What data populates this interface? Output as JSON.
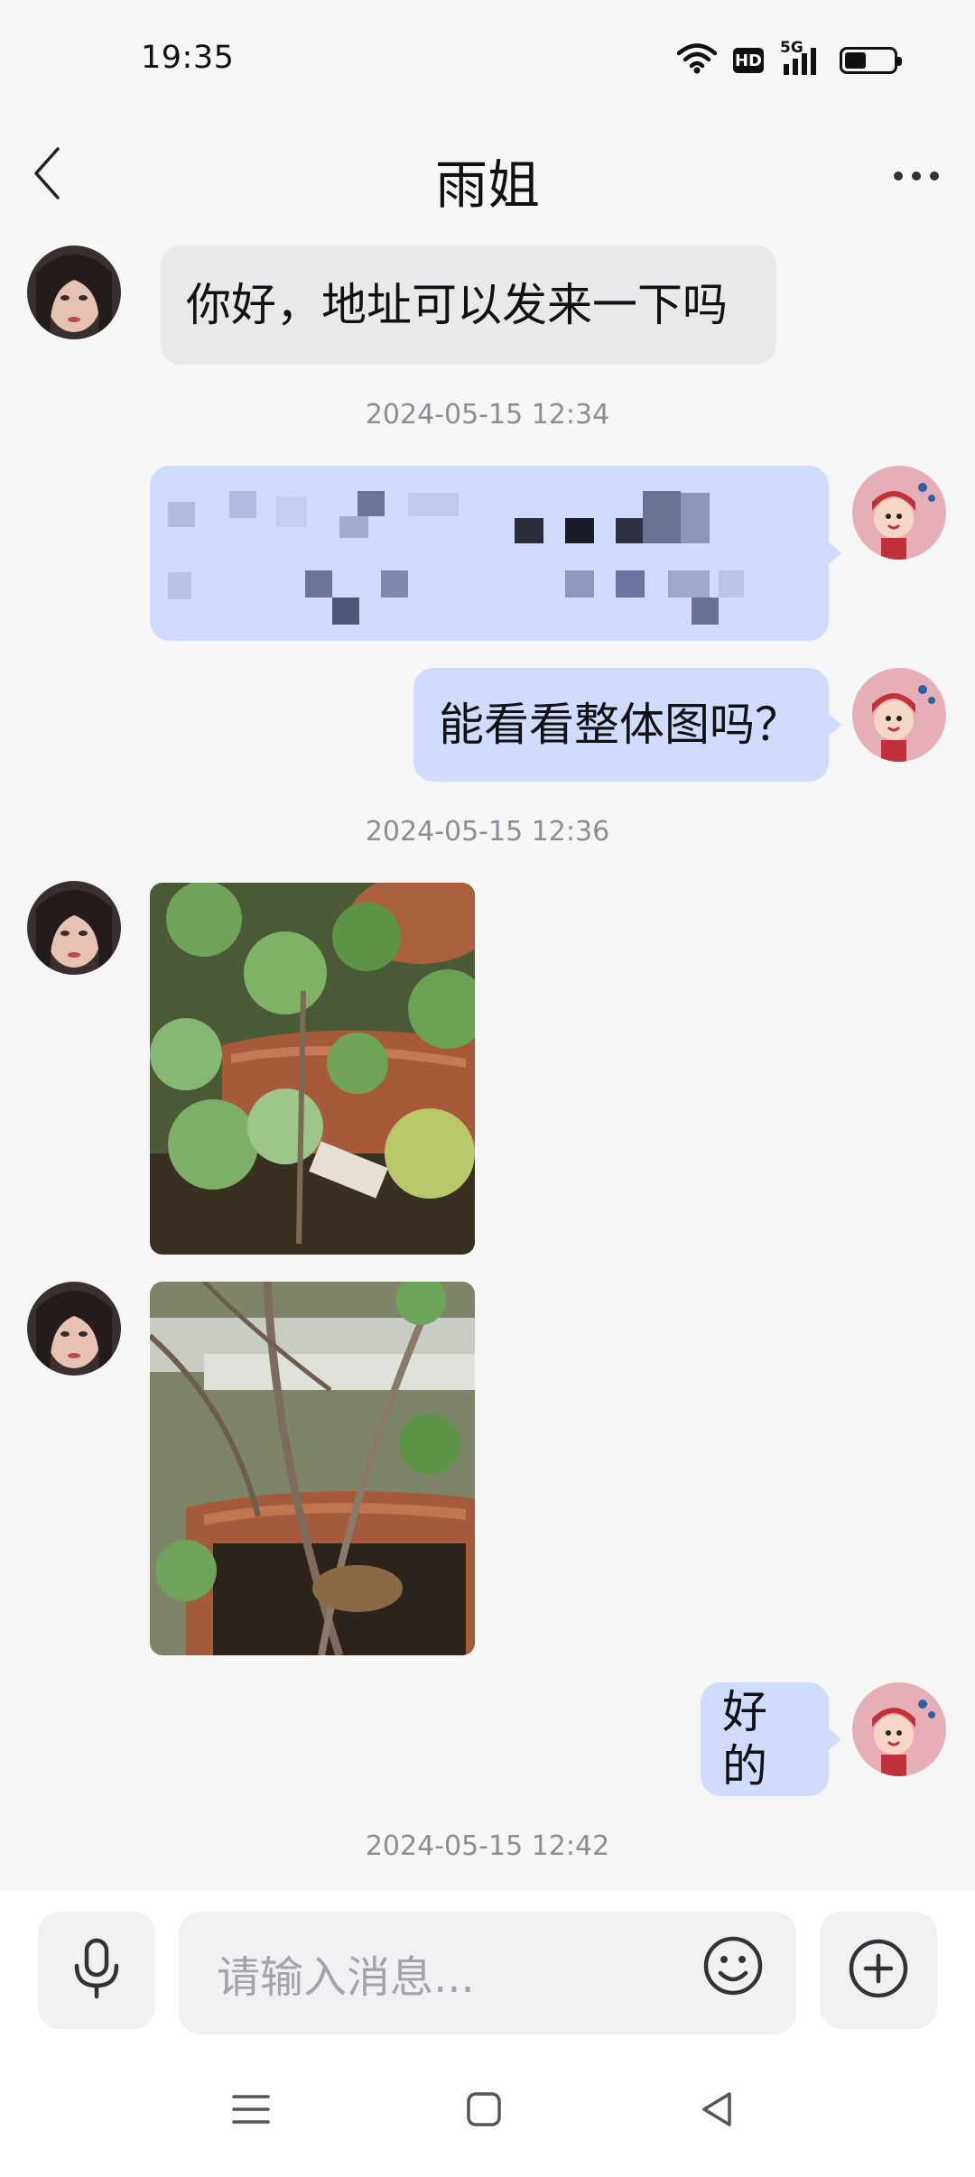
{
  "status_bar": {
    "time": "19:35",
    "hd": "HD",
    "network": "5G",
    "battery_level": 0.45
  },
  "header": {
    "title": "雨姐",
    "back_icon": "chevron-left-icon",
    "more_icon": "more-horizontal-icon"
  },
  "messages": [
    {
      "direction": "in",
      "type": "text",
      "text": "你好，地址可以发来一下吗"
    },
    {
      "type": "timestamp",
      "text": "2024-05-15 12:34"
    },
    {
      "direction": "out",
      "type": "text",
      "text": "",
      "note": "redacted/pixelated address"
    },
    {
      "direction": "out",
      "type": "text",
      "text": "能看看整体图吗？"
    },
    {
      "type": "timestamp",
      "text": "2024-05-15 12:36"
    },
    {
      "direction": "in",
      "type": "image",
      "image": "photo-of-potted-plant-leaves"
    },
    {
      "direction": "in",
      "type": "image",
      "image": "photo-of-potted-plant-stems"
    },
    {
      "direction": "out",
      "type": "text",
      "text": "好的"
    },
    {
      "type": "timestamp",
      "text": "2024-05-15 12:42"
    }
  ],
  "input": {
    "placeholder": "请输入消息..."
  },
  "nav": {
    "menu_icon": "menu-icon",
    "home_icon": "square-home-icon",
    "back_icon": "triangle-back-icon"
  },
  "colors": {
    "background": "#f6f6f7",
    "incoming_bubble": "#e9e9eb",
    "outgoing_bubble": "#cfdcff",
    "timestamp": "#8d8d92"
  }
}
